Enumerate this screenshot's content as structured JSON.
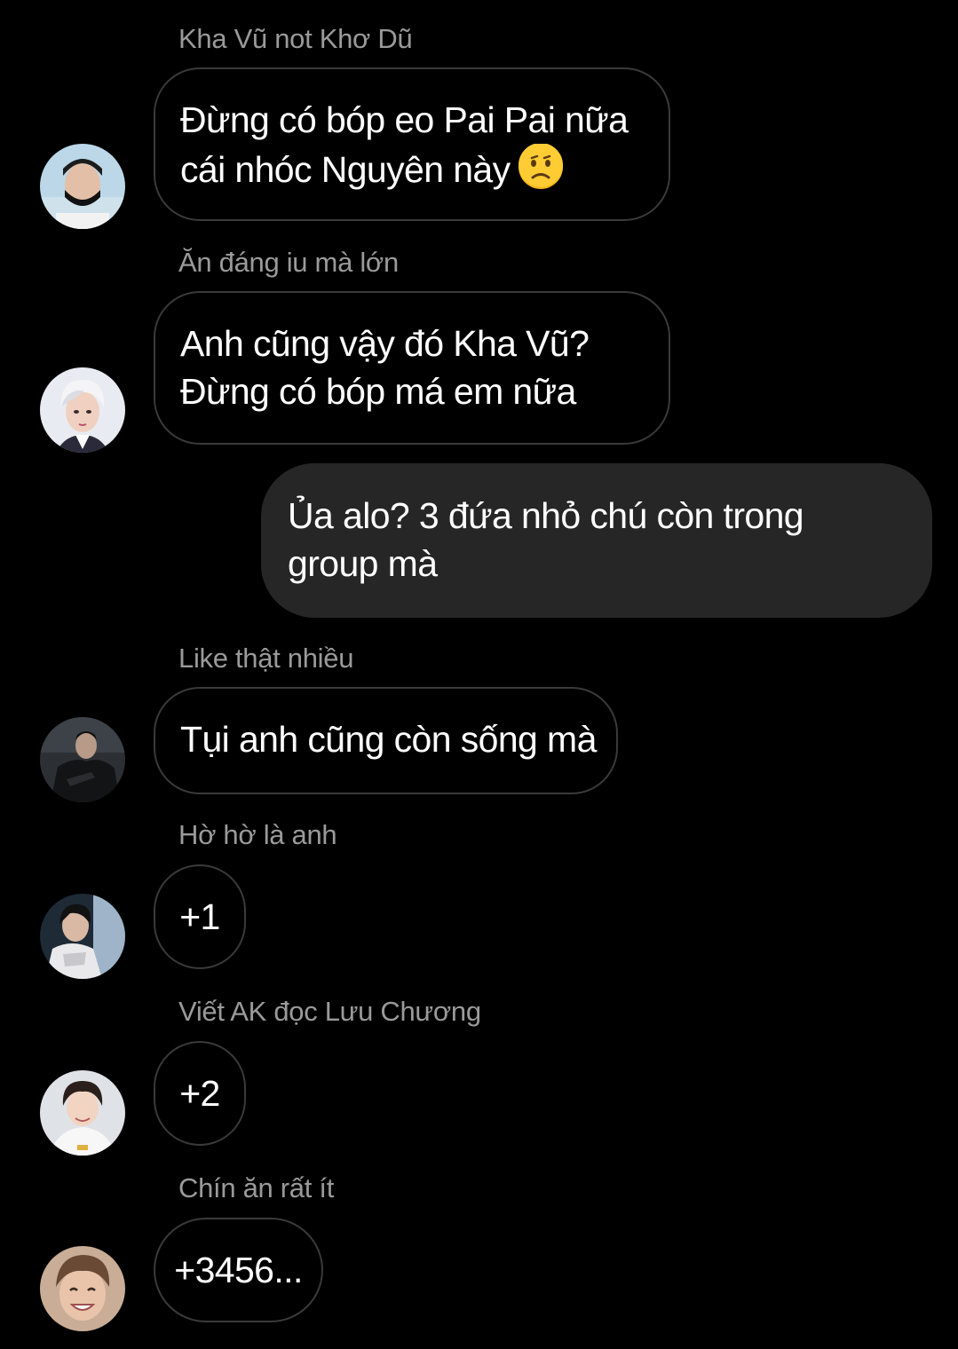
{
  "messages": [
    {
      "sender": "Kha Vũ not Khơ Dũ",
      "lines": [
        "Đừng có bóp eo Pai Pai nữa",
        "cái nhóc Nguyên này"
      ],
      "emoji": "confused-face-emoji",
      "avatar": "avatar-face-mask"
    },
    {
      "sender": "Ăn đáng iu mà lớn",
      "lines": [
        "Anh cũng vậy đó Kha Vũ?",
        "Đừng có bóp má em nữa"
      ],
      "avatar": "avatar-white-hair"
    },
    {
      "sender": "",
      "outgoing": true,
      "lines": [
        "Ủa alo?  3 đứa nhỏ chú còn trong",
        "group mà"
      ]
    },
    {
      "sender": "Like thật nhiều",
      "lines": [
        "Tụi anh cũng còn sống mà"
      ],
      "avatar": "avatar-dark-suit"
    },
    {
      "sender": "Hờ hờ là anh",
      "lines": [
        "+1"
      ],
      "avatar": "avatar-dark-stage"
    },
    {
      "sender": "Viết AK đọc Lưu Chương",
      "lines": [
        "+2"
      ],
      "avatar": "avatar-white-hoodie"
    },
    {
      "sender": "Chín ăn rất ít",
      "lines": [
        "+3456..."
      ],
      "avatar": "avatar-smiling"
    }
  ],
  "colors": {
    "background": "#000000",
    "incoming_border": "#3a3a3a",
    "outgoing_bubble": "#262626",
    "sender_name": "#9a9a9a",
    "text": "#ffffff"
  }
}
